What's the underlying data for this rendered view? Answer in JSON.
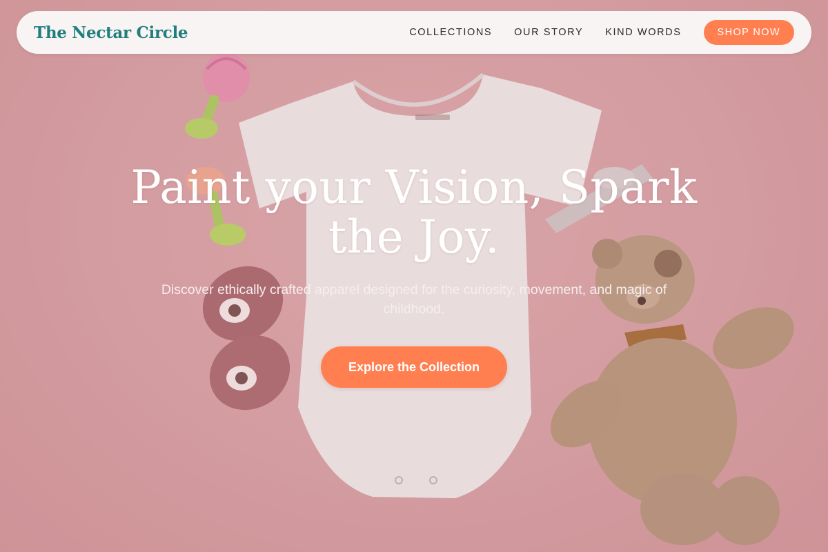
{
  "brand": {
    "name": "The Nectar Circle"
  },
  "nav": {
    "links": [
      "COLLECTIONS",
      "OUR STORY",
      "KIND WORDS"
    ],
    "shop_label": "SHOP NOW"
  },
  "hero": {
    "headline_line1": "Paint your Vision, Spark",
    "headline_line2": "the Joy.",
    "subtext": "Discover ethically crafted apparel designed for the curiosity, movement, and magic of childhood.",
    "cta_label": "Explore the Collection"
  },
  "colors": {
    "accent": "#ff7f50",
    "brand_text": "#1f7f7d",
    "nav_background": "#f8f4f3",
    "hero_background": "#d6a0a4"
  },
  "icons": [
    "baby-onesie-image",
    "teddy-bear-image",
    "baby-shoes-image",
    "teether-toy-image",
    "hair-bow-image"
  ]
}
